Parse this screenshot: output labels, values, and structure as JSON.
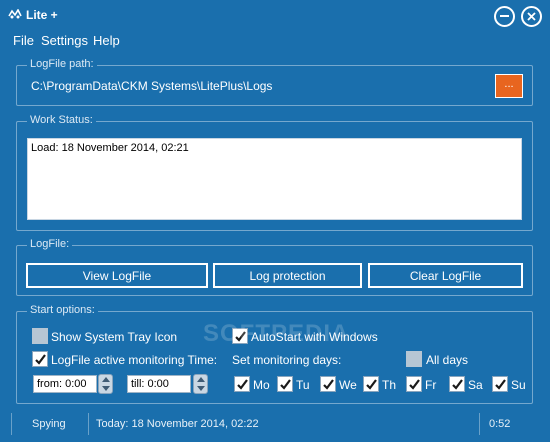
{
  "title_bar": {
    "title": "Lite +"
  },
  "menu": {
    "items": [
      "File",
      "Settings",
      "Help"
    ]
  },
  "logfile_path": {
    "group_title": "LogFile path:",
    "path": "C:\\ProgramData\\CKM Systems\\LitePlus\\Logs",
    "browse_label": "..."
  },
  "work_status": {
    "group_title": "Work Status:",
    "content": "Load: 18 November 2014, 02:21"
  },
  "logfile": {
    "group_title": "LogFile:",
    "buttons": [
      "View LogFile",
      "Log protection",
      "Clear LogFile"
    ]
  },
  "start_options": {
    "group_title": "Start options:",
    "show_tray": {
      "label": "Show System Tray Icon",
      "checked": false
    },
    "autostart": {
      "label": "AutoStart with Windows",
      "checked": true
    },
    "active_monitoring": {
      "label": "LogFile active monitoring Time:",
      "checked": true
    },
    "monitoring_days_label": "Set monitoring days:",
    "all_days": {
      "label": "All days",
      "checked": false
    },
    "from": "from: 0:00",
    "till": "till: 0:00",
    "days": [
      {
        "label": "Mo",
        "checked": true
      },
      {
        "label": "Tu",
        "checked": true
      },
      {
        "label": "We",
        "checked": true
      },
      {
        "label": "Th",
        "checked": true
      },
      {
        "label": "Fr",
        "checked": true
      },
      {
        "label": "Sa",
        "checked": true
      },
      {
        "label": "Su",
        "checked": true
      }
    ]
  },
  "watermark": "SOFTPEDIA",
  "status_bar": {
    "mode": "Spying",
    "today": "Today: 18 November 2014, 02:22",
    "timer": "0:52"
  },
  "colors": {
    "background": "#1a6fad",
    "accent_button": "#e8651f"
  }
}
